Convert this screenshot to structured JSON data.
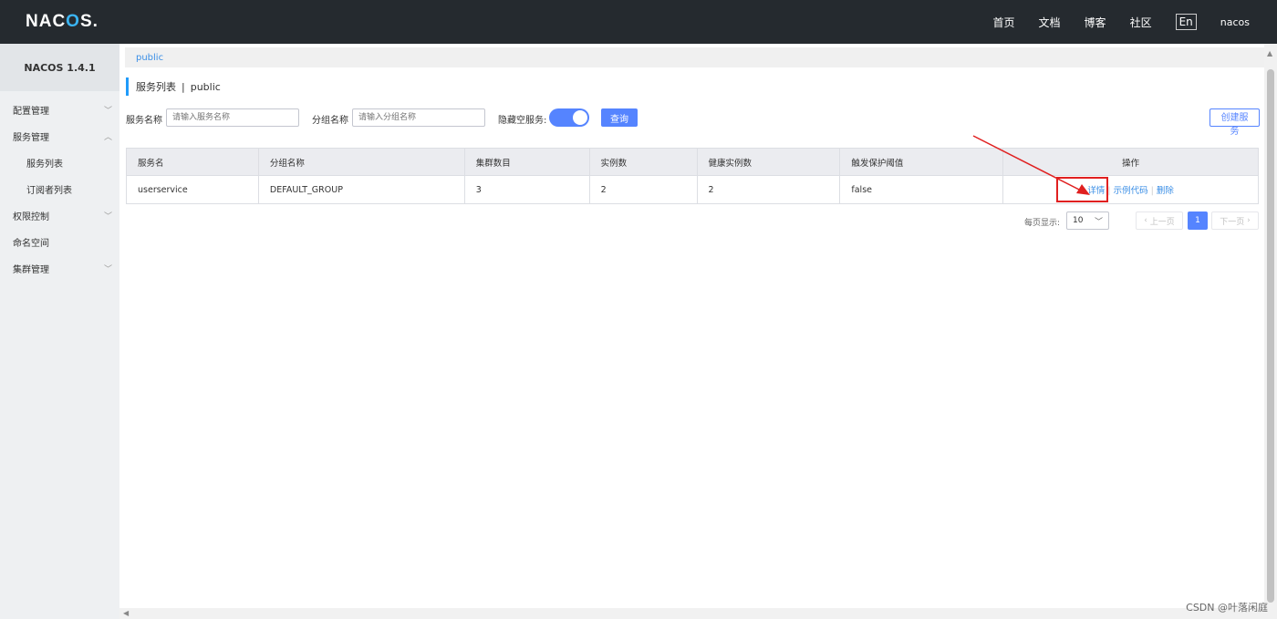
{
  "header": {
    "logo_main": "NAC",
    "logo_accent": "O",
    "logo_tail": "S.",
    "nav": [
      "首页",
      "文档",
      "博客",
      "社区"
    ],
    "lang": "En",
    "user": "nacos"
  },
  "sidebar": {
    "version": "NACOS 1.4.1",
    "items": [
      {
        "label": "配置管理",
        "chevron": "﹀"
      },
      {
        "label": "服务管理",
        "chevron": "︿"
      },
      {
        "label": "服务列表",
        "chevron": ""
      },
      {
        "label": "订阅者列表",
        "chevron": ""
      },
      {
        "label": "权限控制",
        "chevron": "﹀"
      },
      {
        "label": "命名空间",
        "chevron": ""
      },
      {
        "label": "集群管理",
        "chevron": "﹀"
      }
    ]
  },
  "namespace": "public",
  "title": {
    "main": "服务列表",
    "sep": "|",
    "ns": "public"
  },
  "filter": {
    "service_label": "服务名称",
    "service_placeholder": "请输入服务名称",
    "group_label": "分组名称",
    "group_placeholder": "请输入分组名称",
    "hide_empty_label": "隐藏空服务:",
    "query_button": "查询",
    "create_button": "创建服务"
  },
  "table": {
    "headers": [
      "服务名",
      "分组名称",
      "集群数目",
      "实例数",
      "健康实例数",
      "触发保护阈值",
      "操作"
    ],
    "rows": [
      {
        "cells": [
          "userservice",
          "DEFAULT_GROUP",
          "3",
          "2",
          "2",
          "false"
        ],
        "ops": [
          "详情",
          "示例代码",
          "删除"
        ]
      }
    ]
  },
  "pager": {
    "per_page_label": "每页显示:",
    "per_page_value": "10",
    "prev": "上一页",
    "current": "1",
    "next": "下一页"
  },
  "watermark": "CSDN @叶落闲庭",
  "colors": {
    "primary": "#5584ff",
    "annotation": "#e02020",
    "topbar": "#252a2f"
  }
}
